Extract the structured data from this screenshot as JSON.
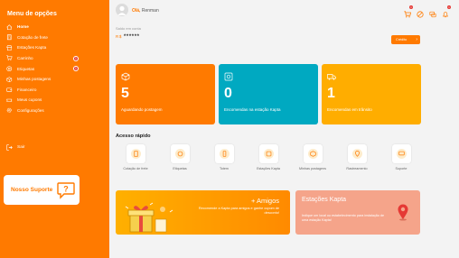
{
  "sidebar": {
    "title": "Menu de opções",
    "items": [
      {
        "label": "Home",
        "icon": "home-icon",
        "badge": ""
      },
      {
        "label": "Cotação de frete",
        "icon": "calculator-icon",
        "badge": ""
      },
      {
        "label": "Estações Kapta",
        "icon": "store-icon",
        "badge": ""
      },
      {
        "label": "Carrinho",
        "icon": "cart-icon",
        "badge": "1"
      },
      {
        "label": "Etiquetas",
        "icon": "tag-icon",
        "badge": "1"
      },
      {
        "label": "Minhas postagens",
        "icon": "package-icon",
        "badge": ""
      },
      {
        "label": "Financeiro",
        "icon": "wallet-icon",
        "badge": ""
      },
      {
        "label": "Meus cupons",
        "icon": "coupon-icon",
        "badge": ""
      },
      {
        "label": "Configurações",
        "icon": "gear-icon",
        "badge": ""
      }
    ],
    "logout_label": "Sair",
    "support_label": "Nosso Suporte"
  },
  "header": {
    "greeting": "Olá,",
    "user_name": "Renman",
    "icons": [
      {
        "name": "cart-icon",
        "badge": "1"
      },
      {
        "name": "tag-icon",
        "badge": ""
      },
      {
        "name": "chat-icon",
        "badge": ""
      },
      {
        "name": "bell-icon",
        "badge": "1"
      }
    ]
  },
  "balance": {
    "label": "Saldo em conta",
    "currency": "R$",
    "value": "******",
    "button_label": "Crédito"
  },
  "stats": [
    {
      "value": "5",
      "label": "Aguardando postagem",
      "icon": "box-icon",
      "color": "#ff7a00"
    },
    {
      "value": "0",
      "label": "Encomendas na estação Kapta",
      "icon": "station-icon",
      "color": "#00a9c1"
    },
    {
      "value": "1",
      "label": "Encomendas em trânsito",
      "icon": "truck-icon",
      "color": "#ffad00"
    }
  ],
  "quick_access": {
    "title": "Acesso rápido",
    "items": [
      {
        "label": "Cotação de frete",
        "icon": "calculator-icon"
      },
      {
        "label": "Etiquetas",
        "icon": "tag-icon"
      },
      {
        "label": "Totem",
        "icon": "totem-icon"
      },
      {
        "label": "Estações Kapta",
        "icon": "station-icon"
      },
      {
        "label": "Minhas postagens",
        "icon": "package-icon"
      },
      {
        "label": "Rastreamento",
        "icon": "tracking-icon"
      },
      {
        "label": "Suporte",
        "icon": "support-icon"
      }
    ]
  },
  "banners": {
    "friends_title": "+ Amigos",
    "friends_desc": "Recomende a Kapta para amigos e ganhe cupom de desconto!",
    "stations_title": "Estações Kapta",
    "stations_desc": "Indique um local ou estabelecimento para instalação de uma estação Kapta!"
  },
  "colors": {
    "primary": "#ff7a00",
    "teal": "#00a9c1",
    "yellow": "#ffad00",
    "badge": "#e53935"
  }
}
